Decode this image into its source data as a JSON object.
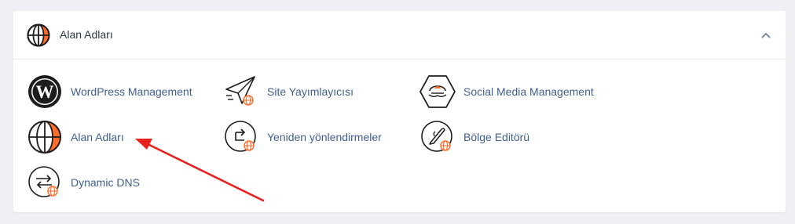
{
  "section": {
    "title": "Alan Adları",
    "icon": "globe-icon",
    "collapse_icon": "chevron-up-icon",
    "accent_color": "#ff6c2c"
  },
  "items": [
    {
      "label": "WordPress Management",
      "icon": "wordpress-icon"
    },
    {
      "label": "Site Yayımlayıcısı",
      "icon": "site-publisher-icon"
    },
    {
      "label": "Social Media Management",
      "icon": "social-media-icon"
    },
    {
      "label": "Alan Adları",
      "icon": "globe-icon"
    },
    {
      "label": "Yeniden yönlendirmeler",
      "icon": "redirect-icon"
    },
    {
      "label": "Bölge Editörü",
      "icon": "zone-editor-icon"
    },
    {
      "label": "Dynamic DNS",
      "icon": "dynamic-dns-icon"
    }
  ],
  "annotation": {
    "type": "arrow",
    "color": "#e8201e"
  }
}
